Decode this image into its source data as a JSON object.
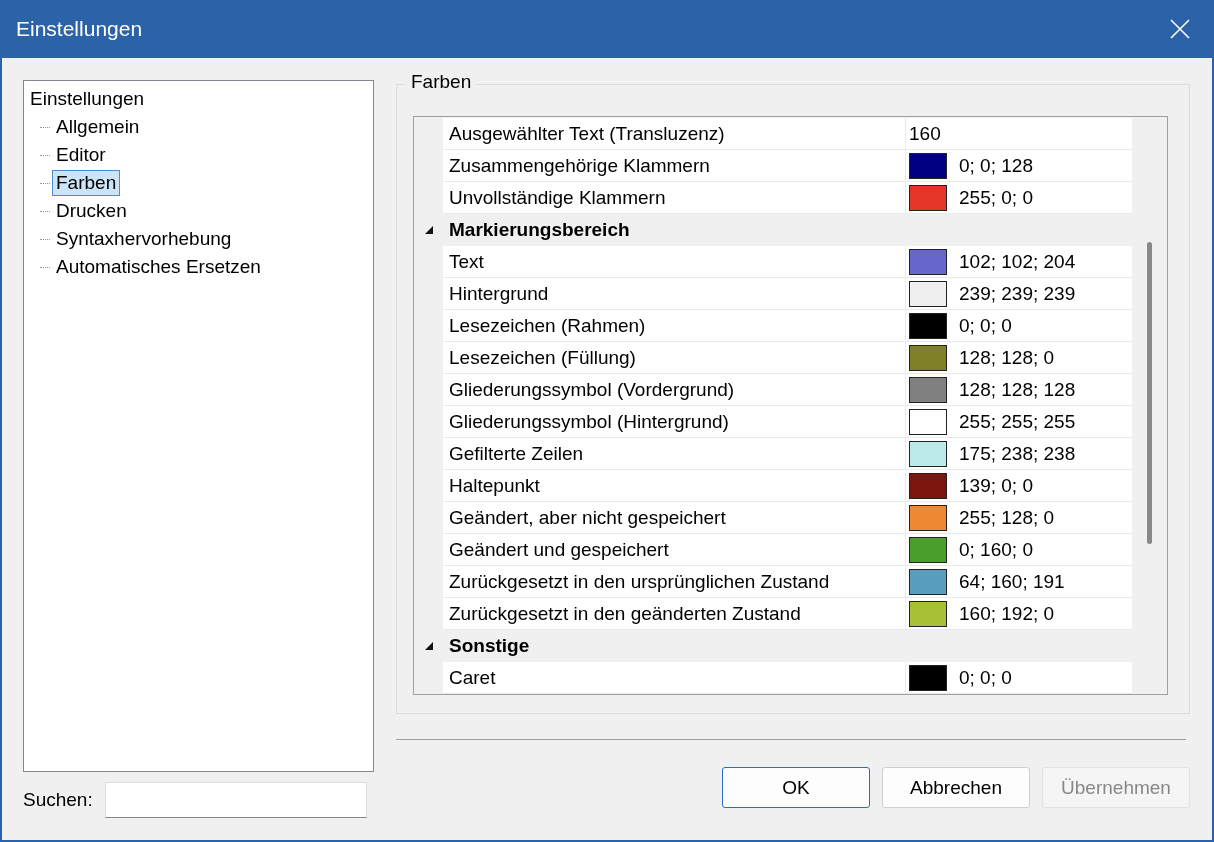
{
  "window": {
    "title": "Einstellungen"
  },
  "tree": {
    "label": "Einstellungen",
    "children": [
      {
        "label": "Allgemein",
        "selected": false
      },
      {
        "label": "Editor",
        "selected": false
      },
      {
        "label": "Farben",
        "selected": true
      },
      {
        "label": "Drucken",
        "selected": false
      },
      {
        "label": "Syntaxhervorhebung",
        "selected": false
      },
      {
        "label": "Automatisches Ersetzen",
        "selected": false
      }
    ]
  },
  "search": {
    "label": "Suchen:"
  },
  "group": {
    "title": "Farben"
  },
  "rows": [
    {
      "kind": "property",
      "label": "Ausgewählter Text (Transluzenz)",
      "value": "160"
    },
    {
      "kind": "property",
      "label": "Zusammengehörige Klammern",
      "value": "0; 0; 128",
      "color": "#000080"
    },
    {
      "kind": "property",
      "label": "Unvollständige Klammern",
      "value": "255; 0; 0",
      "color": "#e8352a"
    },
    {
      "kind": "category",
      "label": "Markierungsbereich",
      "expanded": true
    },
    {
      "kind": "property",
      "label": "Text",
      "value": "102; 102; 204",
      "color": "#6666cc"
    },
    {
      "kind": "property",
      "label": "Hintergrund",
      "value": "239; 239; 239",
      "color": "#efefef"
    },
    {
      "kind": "property",
      "label": "Lesezeichen (Rahmen)",
      "value": "0; 0; 0",
      "color": "#000000"
    },
    {
      "kind": "property",
      "label": "Lesezeichen (Füllung)",
      "value": "128; 128; 0",
      "color": "#808028"
    },
    {
      "kind": "property",
      "label": "Gliederungssymbol (Vordergrund)",
      "value": "128; 128; 128",
      "color": "#808080"
    },
    {
      "kind": "property",
      "label": "Gliederungssymbol (Hintergrund)",
      "value": "255; 255; 255",
      "color": "#ffffff"
    },
    {
      "kind": "property",
      "label": "Gefilterte Zeilen",
      "value": "175; 238; 238",
      "color": "#bbeaea"
    },
    {
      "kind": "property",
      "label": "Haltepunkt",
      "value": "139; 0; 0",
      "color": "#7e1610"
    },
    {
      "kind": "property",
      "label": "Geändert, aber nicht gespeichert",
      "value": "255; 128; 0",
      "color": "#ee8833"
    },
    {
      "kind": "property",
      "label": "Geändert und gespeichert",
      "value": "0; 160; 0",
      "color": "#4a9e2e"
    },
    {
      "kind": "property",
      "label": "Zurückgesetzt in den ursprünglichen Zustand",
      "value": "64; 160; 191",
      "color": "#5a9ebd"
    },
    {
      "kind": "property",
      "label": "Zurückgesetzt in den geänderten Zustand",
      "value": "160; 192; 0",
      "color": "#a8bf38"
    },
    {
      "kind": "category",
      "label": "Sonstige",
      "expanded": true
    },
    {
      "kind": "property",
      "label": "Caret",
      "value": "0; 0; 0",
      "color": "#000000"
    }
  ],
  "buttons": [
    {
      "label": "OK",
      "default": true,
      "disabled": false
    },
    {
      "label": "Abbrechen",
      "default": false,
      "disabled": false
    },
    {
      "label": "Übernehmen",
      "default": false,
      "disabled": true
    }
  ]
}
